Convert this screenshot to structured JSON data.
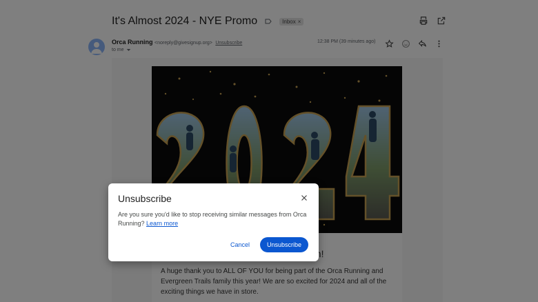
{
  "email": {
    "subject": "It's Almost 2024 - NYE Promo",
    "label_chip": "Inbox",
    "chip_remove": "×",
    "sender_name": "Orca Running",
    "sender_email": "<noreply@givesignup.org>",
    "sender_unsubscribe": "Unsubscribe",
    "to": "to me",
    "timestamp": "12:38 PM (39 minutes ago)",
    "hero_text": "2024",
    "heading_tail": "en!",
    "paragraph": "A huge thank you to ALL OF YOU for being part of the Orca Running and Evergreen Trails family this year! We are so excited for 2024 and all of the exciting things we have in store."
  },
  "icons": {
    "label": "label-outline-icon",
    "print": "print-icon",
    "open_new": "open-in-new-icon",
    "avatar": "person-icon",
    "star": "star-icon",
    "emoji": "emoji-icon",
    "reply": "reply-icon",
    "more": "more-vert-icon",
    "close": "close-icon",
    "dropdown": "chevron-down-icon"
  },
  "dialog": {
    "title": "Unsubscribe",
    "message": "Are you sure you'd like to stop receiving similar messages from Orca Running?",
    "link": "Learn more",
    "cancel": "Cancel",
    "confirm": "Unsubscribe"
  },
  "colors": {
    "accent": "#0b57d0",
    "scrim": "rgba(0,0,0,0.5)"
  }
}
